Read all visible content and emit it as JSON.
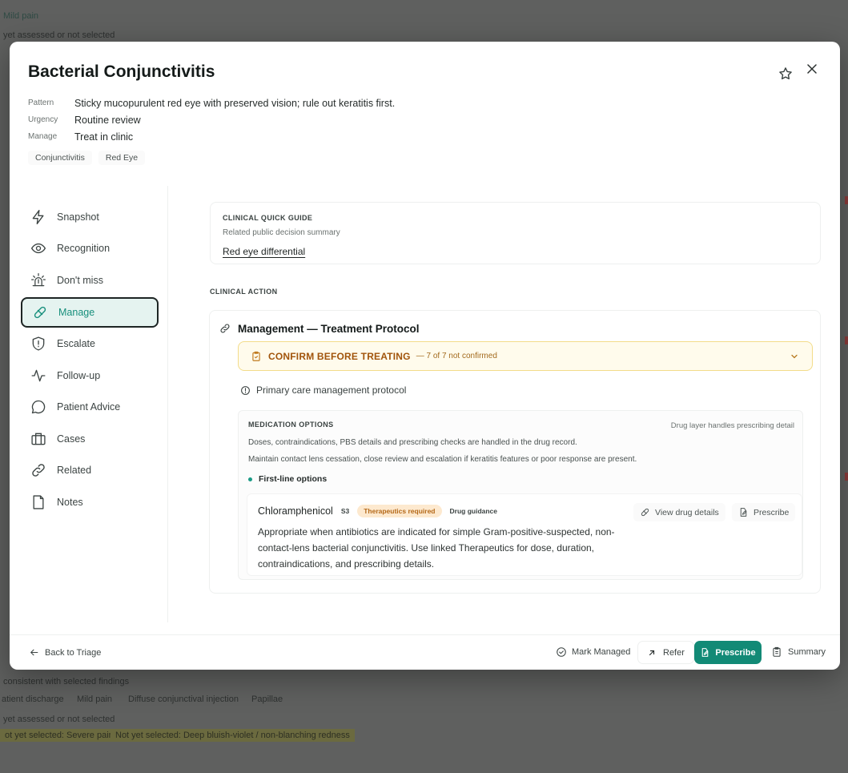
{
  "background": {
    "lines": [
      "Mild pain",
      "yet assessed or not selected",
      "consistent with selected findings",
      "atient discharge",
      "Mild pain",
      "Diffuse conjunctival injection",
      "Papillae",
      "yet assessed or not selected",
      "ot yet selected: Severe pain",
      "Not yet selected: Deep bluish-violet / non-blanching redness"
    ]
  },
  "modal": {
    "title": "Bacterial Conjunctivitis",
    "meta": [
      {
        "key": "Pattern",
        "value": "Sticky mucopurulent red eye with preserved vision; rule out keratitis first."
      },
      {
        "key": "Urgency",
        "value": "Routine review"
      },
      {
        "key": "Manage",
        "value": "Treat in clinic"
      }
    ],
    "tags": [
      "Conjunctivitis",
      "Red Eye"
    ],
    "icons": {
      "star": "star-icon",
      "close": "close-icon"
    }
  },
  "sidebar": {
    "items": [
      {
        "label": "Snapshot",
        "icon": "lightning-icon"
      },
      {
        "label": "Recognition",
        "icon": "eye-icon"
      },
      {
        "label": "Don't miss",
        "icon": "alarm-icon"
      },
      {
        "label": "Manage",
        "icon": "pill-icon",
        "active": true
      },
      {
        "label": "Escalate",
        "icon": "shield-alert-icon"
      },
      {
        "label": "Follow-up",
        "icon": "pulse-icon"
      },
      {
        "label": "Patient Advice",
        "icon": "chat-icon"
      },
      {
        "label": "Cases",
        "icon": "briefcase-icon"
      },
      {
        "label": "Related",
        "icon": "link-icon"
      },
      {
        "label": "Notes",
        "icon": "note-icon"
      }
    ]
  },
  "quick_guide": {
    "label": "CLINICAL QUICK GUIDE",
    "subtitle": "Related public decision summary",
    "link": "Red eye differential"
  },
  "clinical_action": {
    "label": "CLINICAL ACTION",
    "title": "Management — Treatment Protocol",
    "confirm": {
      "title": "CONFIRM BEFORE TREATING",
      "status": "— 7 of 7 not confirmed"
    },
    "protocol": "Primary care management protocol",
    "medication": {
      "label": "MEDICATION OPTIONS",
      "note": "Drug layer handles prescribing detail",
      "line1": "Doses, contraindications, PBS details and prescribing checks are handled in the drug record.",
      "line2": "Maintain contact lens cessation, close review and escalation if keratitis features or poor response are present.",
      "group": "First-line options",
      "drug": {
        "name": "Chloramphenicol",
        "schedule": "S3",
        "badge_required": "Therapeutics required",
        "badge_guidance": "Drug guidance",
        "desc_line1": "Appropriate when antibiotics are indicated for simple Gram-positive-suspected, non-",
        "desc_line2": "contact-lens bacterial conjunctivitis. Use linked Therapeutics for dose, duration,",
        "desc_line3": "contraindications, and prescribing details.",
        "view_label": "View drug details",
        "prescribe_label": "Prescribe"
      }
    }
  },
  "footer": {
    "back": "Back to Triage",
    "mark_managed": "Mark Managed",
    "refer": "Refer",
    "prescribe": "Prescribe",
    "summary": "Summary"
  },
  "colors": {
    "accent": "#128a76",
    "accent_text": "#178f7c",
    "warning_bg": "#fffbec",
    "warning_border": "#f3dc8a",
    "warning_text": "#a1540b"
  }
}
